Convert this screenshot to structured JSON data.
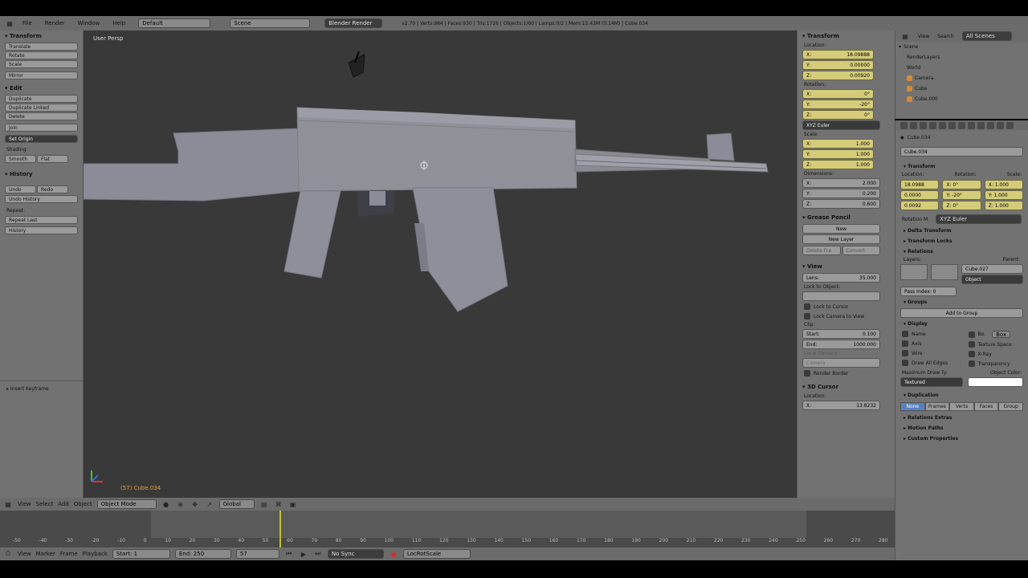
{
  "top_menu": {
    "items": [
      "File",
      "Render",
      "Window",
      "Help"
    ],
    "layout": "Default",
    "scene": "Scene",
    "engine": "Blender Render",
    "stats": "v2.70 | Verts:984 | Faces:930 | Tris:1726 | Objects:1/60 | Lamps:0/2 | Mem:15.43M (0.14M) | Cube.034"
  },
  "toolshelf": {
    "transform_header": "Transform",
    "transform_buttons": [
      "Translate",
      "Rotate",
      "Scale",
      "Mirror"
    ],
    "edit_header": "Edit",
    "edit_buttons": [
      "Duplicate",
      "Duplicate Linked",
      "Delete",
      "Join"
    ],
    "set_origin": "Set Origin",
    "shading_label": "Shading:",
    "smooth": "Smooth",
    "flat": "Flat",
    "history_header": "History",
    "undo": "Undo",
    "redo": "Redo",
    "undo_history": "Undo History",
    "repeat_label": "Repeat:",
    "repeat_last": "Repeat Last",
    "history_btn": "History",
    "op_panel": "Insert Keyframe"
  },
  "viewport": {
    "view_label": "User Persp",
    "object_label": "(57) Cube.034"
  },
  "npanel": {
    "transform_header": "Transform",
    "location_label": "Location:",
    "location": [
      {
        "axis": "X:",
        "value": "18.09888"
      },
      {
        "axis": "Y:",
        "value": "0.00000"
      },
      {
        "axis": "Z:",
        "value": "0.00920"
      }
    ],
    "rotation_label": "Rotation:",
    "rotation": [
      {
        "axis": "X:",
        "value": "0°"
      },
      {
        "axis": "Y:",
        "value": "-20°"
      },
      {
        "axis": "Z:",
        "value": "0°"
      }
    ],
    "rotation_mode": "XYZ Euler",
    "scale_label": "Scale:",
    "scale": [
      {
        "axis": "X:",
        "value": "1.000"
      },
      {
        "axis": "Y:",
        "value": "1.000"
      },
      {
        "axis": "Z:",
        "value": "1.000"
      }
    ],
    "dimensions_label": "Dimensions:",
    "dimensions": [
      {
        "axis": "X:",
        "value": "2.000"
      },
      {
        "axis": "Y:",
        "value": "0.200"
      },
      {
        "axis": "Z:",
        "value": "0.600"
      }
    ],
    "grease_header": "Grease Pencil",
    "new": "New",
    "new_layer": "New Layer",
    "delete_frame": "Delete Fra.",
    "convert": "Convert",
    "view_header": "View",
    "lens_label": "Lens:",
    "lens_value": "35.000",
    "lock_object": "Lock to Object:",
    "lock_cursor": "Lock to Cursor",
    "lock_camera": "Lock Camera to View",
    "clip_label": "Clip:",
    "clip_start_label": "Start:",
    "clip_start": "0.100",
    "clip_end_label": "End:",
    "clip_end": "1000.000",
    "local_camera": "Local Camera:",
    "camera": "Camera",
    "render_border": "Render Border",
    "cursor_header": "3D Cursor",
    "cursor_location": "Location:",
    "cursor_x_label": "X:",
    "cursor_x": "13.8232"
  },
  "outliner": {
    "view": "View",
    "search": "Search",
    "all_scenes": "All Scenes",
    "rows": [
      "Scene",
      "RenderLayers",
      "World",
      "Camera",
      "Cube",
      "Cube.000"
    ]
  },
  "properties": {
    "object_name": "Cube.034",
    "transform_header": "Transform",
    "location_label": "Location:",
    "rotation_label": "Rotation:",
    "scale_label": "Scale:",
    "loc": [
      "18.0988",
      "0.0000",
      "0.0092"
    ],
    "rot": [
      "X: 0°",
      "Y: -20°",
      "Z: 0°"
    ],
    "scl": [
      "X: 1.000",
      "Y: 1.000",
      "Z: 1.000"
    ],
    "rotation_mode_label": "Rotation M.",
    "rotation_mode": "XYZ Euler",
    "delta": "Delta Transform",
    "locks": "Transform Locks",
    "relations": "Relations",
    "layers_label": "Layers:",
    "parent_label": "Parent:",
    "parent": "Cube.027",
    "parent_type": "Object",
    "pass_index": "Pass Index: 0",
    "groups": "Groups",
    "add_group": "Add to Group",
    "display": "Display",
    "display_checks_left": [
      "Name",
      "Axis",
      "Wire",
      "Draw All Edges"
    ],
    "display_checks_right": [
      "Bo.",
      "Texture Space",
      "X-Ray",
      "Transparency"
    ],
    "bounds": "Box",
    "max_draw_label": "Maximum Draw Ty:",
    "max_draw": "Textured",
    "object_color_label": "Object Color:",
    "duplication": "Duplication",
    "dup_tabs": [
      "None",
      "Frames",
      "Verts",
      "Faces",
      "Group"
    ],
    "relations_extras": "Relations Extras",
    "motion_paths": "Motion Paths",
    "custom_props": "Custom Properties"
  },
  "view3d_header": {
    "view": "View",
    "select": "Select",
    "add": "Add",
    "object": "Object",
    "mode": "Object Mode",
    "orientation": "Global"
  },
  "timeline": {
    "ticks": [
      "-50",
      "-40",
      "-30",
      "-20",
      "-10",
      "0",
      "10",
      "20",
      "30",
      "40",
      "50",
      "60",
      "70",
      "80",
      "90",
      "100",
      "110",
      "120",
      "130",
      "140",
      "150",
      "160",
      "170",
      "180",
      "190",
      "200",
      "210",
      "220",
      "230",
      "240",
      "250",
      "260",
      "270",
      "280"
    ],
    "current_frame": 57
  },
  "timeline_header": {
    "view": "View",
    "marker": "Marker",
    "frame": "Frame",
    "playback": "Playback",
    "start_label": "Start:",
    "start": "1",
    "end_label": "End:",
    "end": "250",
    "current": "57",
    "sync": "No Sync",
    "keying": "LocRotScale"
  }
}
